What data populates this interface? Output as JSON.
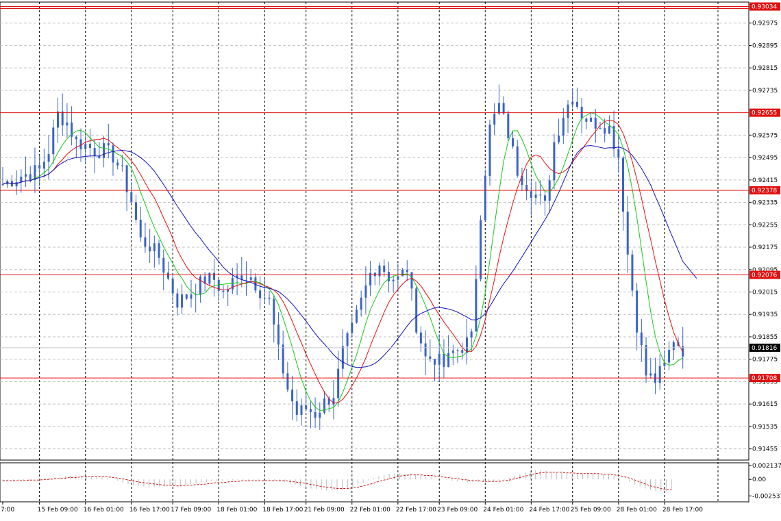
{
  "chart_data": [
    {
      "type": "candlestick",
      "title": "",
      "colors": {
        "candles": "#3a63c8",
        "sma_fast": "#16c816",
        "sma_mid": "#e01010",
        "sma_slow": "#1010c0",
        "level_lines": "#e01010",
        "grid": "#c0c0c0",
        "current_price_bg": "#000000",
        "level_label_bg": "#e01010"
      },
      "ylim": [
        0.91415,
        0.9305
      ],
      "y_ticks": [
        "0.92975",
        "0.92895",
        "0.92815",
        "0.92735",
        "0.92575",
        "0.92495",
        "0.92415",
        "0.92335",
        "0.92255",
        "0.92175",
        "0.92095",
        "0.92015",
        "0.91935",
        "0.91855",
        "0.91775",
        "0.91695",
        "0.91615",
        "0.91535",
        "0.91455"
      ],
      "x_ticks": [
        "7:00",
        "15 Feb 09:00",
        "16 Feb 01:00",
        "16 Feb 17:00",
        "17 Feb 09:00",
        "18 Feb 01:00",
        "18 Feb 17:00",
        "21 Feb 09:00",
        "22 Feb 01:00",
        "22 Feb 17:00",
        "23 Feb 09:00",
        "24 Feb 01:00",
        "24 Feb 17:00",
        "25 Feb 09:00",
        "28 Feb 01:00",
        "28 Feb 17:00"
      ],
      "levels": [
        {
          "value": 0.93034,
          "label": "0.93034"
        },
        {
          "value": 0.92655,
          "label": "0.92655"
        },
        {
          "value": 0.92378,
          "label": "0.92378"
        },
        {
          "value": 0.92076,
          "label": "0.92076"
        },
        {
          "value": 0.91708,
          "label": "0.91708"
        }
      ],
      "current_price": {
        "value": 0.91816,
        "label": "0.91816"
      },
      "close_path": [
        [
          0,
          0.924
        ],
        [
          4,
          0.9243
        ],
        [
          8,
          0.9245
        ],
        [
          10,
          0.9252
        ],
        [
          12,
          0.9265
        ],
        [
          14,
          0.9262
        ],
        [
          16,
          0.9255
        ],
        [
          18,
          0.9254
        ],
        [
          20,
          0.9252
        ],
        [
          22,
          0.9252
        ],
        [
          24,
          0.925
        ],
        [
          26,
          0.9244
        ],
        [
          28,
          0.9234
        ],
        [
          30,
          0.922
        ],
        [
          32,
          0.9218
        ],
        [
          34,
          0.9214
        ],
        [
          36,
          0.9206
        ],
        [
          38,
          0.9198
        ],
        [
          40,
          0.92
        ],
        [
          42,
          0.9203
        ],
        [
          44,
          0.9206
        ],
        [
          46,
          0.9206
        ],
        [
          48,
          0.9201
        ],
        [
          50,
          0.9205
        ],
        [
          52,
          0.9208
        ],
        [
          54,
          0.9207
        ],
        [
          56,
          0.9202
        ],
        [
          58,
          0.9198
        ],
        [
          60,
          0.918
        ],
        [
          62,
          0.9167
        ],
        [
          64,
          0.9158
        ],
        [
          66,
          0.916
        ],
        [
          68,
          0.9158
        ],
        [
          70,
          0.9162
        ],
        [
          72,
          0.9165
        ],
        [
          74,
          0.918
        ],
        [
          76,
          0.9188
        ],
        [
          78,
          0.9198
        ],
        [
          80,
          0.9208
        ],
        [
          82,
          0.9212
        ],
        [
          84,
          0.9207
        ],
        [
          86,
          0.9206
        ],
        [
          88,
          0.921
        ],
        [
          90,
          0.919
        ],
        [
          92,
          0.9178
        ],
        [
          94,
          0.9178
        ],
        [
          96,
          0.9175
        ],
        [
          98,
          0.918
        ],
        [
          100,
          0.9182
        ],
        [
          102,
          0.9185
        ],
        [
          104,
          0.923
        ],
        [
          106,
          0.926
        ],
        [
          108,
          0.9268
        ],
        [
          110,
          0.9258
        ],
        [
          112,
          0.9245
        ],
        [
          114,
          0.924
        ],
        [
          116,
          0.9236
        ],
        [
          118,
          0.9232
        ],
        [
          120,
          0.9255
        ],
        [
          122,
          0.9265
        ],
        [
          124,
          0.9272
        ],
        [
          126,
          0.9265
        ],
        [
          128,
          0.9262
        ],
        [
          130,
          0.9262
        ],
        [
          132,
          0.926
        ],
        [
          134,
          0.925
        ],
        [
          136,
          0.9215
        ],
        [
          138,
          0.919
        ],
        [
          140,
          0.9172
        ],
        [
          142,
          0.917
        ],
        [
          144,
          0.9175
        ],
        [
          146,
          0.9185
        ],
        [
          148,
          0.9181
        ]
      ],
      "x_labels_per_bar": [
        {
          "label": "7:00",
          "bar": 0
        },
        {
          "label": "15 Feb 09:00",
          "bar": 8
        },
        {
          "label": "16 Feb 01:00",
          "bar": 18
        },
        {
          "label": "16 Feb 17:00",
          "bar": 28
        },
        {
          "label": "17 Feb 09:00",
          "bar": 37
        },
        {
          "label": "18 Feb 01:00",
          "bar": 47
        },
        {
          "label": "18 Feb 17:00",
          "bar": 57
        },
        {
          "label": "21 Feb 09:00",
          "bar": 66
        },
        {
          "label": "22 Feb 01:00",
          "bar": 76
        },
        {
          "label": "22 Feb 17:00",
          "bar": 86
        },
        {
          "label": "23 Feb 09:00",
          "bar": 95
        },
        {
          "label": "24 Feb 01:00",
          "bar": 105
        },
        {
          "label": "24 Feb 17:00",
          "bar": 115
        },
        {
          "label": "25 Feb 09:00",
          "bar": 124
        },
        {
          "label": "28 Feb 01:00",
          "bar": 134
        },
        {
          "label": "28 Feb 17:00",
          "bar": 144
        }
      ]
    },
    {
      "type": "histogram",
      "title": "",
      "ylim": [
        -0.00345,
        0.00255
      ],
      "y_ticks": [
        "0.002137",
        "0.00",
        "-0.002537"
      ],
      "series": [
        {
          "values": [
            -0.0003,
            -0.0003,
            -0.0002,
            -0.0002,
            -0.0001,
            -0.0001,
            0.0,
            0.0001,
            0.0001,
            0.0002,
            0.0003,
            0.0004,
            0.0005,
            0.0006,
            0.0006,
            0.0006,
            0.0005,
            0.0005,
            0.0004,
            0.0003,
            0.0002,
            0.0,
            -0.0002,
            -0.0005,
            -0.0007,
            -0.0009,
            -0.001,
            -0.0011,
            -0.0012,
            -0.0012,
            -0.0011,
            -0.0011,
            -0.001,
            -0.001,
            -0.0009,
            -0.0008,
            -0.0007,
            -0.0006,
            -0.0005,
            -0.0004,
            -0.0003,
            -0.0002,
            -0.0002,
            -0.0001,
            -0.0001,
            -0.0001,
            -0.0001,
            -0.0001,
            -0.0001,
            -0.0001,
            -0.0002,
            -0.0002,
            -0.0002,
            -0.0003,
            -0.0004,
            -0.0006,
            -0.0008,
            -0.001,
            -0.0012,
            -0.0014,
            -0.0015,
            -0.0016,
            -0.0017,
            -0.0017,
            -0.0017,
            -0.0016,
            -0.0014,
            -0.0011,
            -0.0008,
            -0.0005,
            -0.0001,
            0.0002,
            0.0005,
            0.0007,
            0.0008,
            0.0009,
            0.0009,
            0.0009,
            0.0008,
            0.0007,
            0.0006,
            0.0004,
            0.0003,
            0.0001,
            0.0,
            -0.0001,
            -0.0002,
            -0.0003,
            -0.0003,
            -0.0004,
            -0.0004,
            -0.0004,
            -0.0004,
            -0.0004,
            -0.0003,
            -0.0002,
            -0.0001,
            0.0002,
            0.0005,
            0.0008,
            0.0011,
            0.0013,
            0.0014,
            0.0014,
            0.0013,
            0.0012,
            0.0011,
            0.001,
            0.0009,
            0.0008,
            0.0008,
            0.0009,
            0.0009,
            0.0009,
            0.0008,
            0.0008,
            0.0007,
            0.0005,
            0.0003,
            0.0,
            -0.0004,
            -0.0008,
            -0.0011,
            -0.0014,
            -0.0016,
            -0.0018,
            -0.0018,
            -0.0018,
            -0.0017
          ]
        },
        {
          "values": [
            -0.0002,
            -0.0002,
            -0.0002,
            -0.0002,
            -0.0002,
            -0.0001,
            -0.0001,
            -0.0001,
            0.0,
            0.0,
            0.0001,
            0.0001,
            0.0002,
            0.0003,
            0.0003,
            0.0004,
            0.0004,
            0.0004,
            0.0004,
            0.0004,
            0.0004,
            0.0003,
            0.0002,
            0.0001,
            -0.0001,
            -0.0002,
            -0.0004,
            -0.0005,
            -0.0006,
            -0.0007,
            -0.0008,
            -0.0009,
            -0.0009,
            -0.001,
            -0.001,
            -0.0009,
            -0.0009,
            -0.0008,
            -0.0008,
            -0.0007,
            -0.0006,
            -0.0005,
            -0.0005,
            -0.0004,
            -0.0003,
            -0.0003,
            -0.0002,
            -0.0002,
            -0.0002,
            -0.0002,
            -0.0002,
            -0.0002,
            -0.0002,
            -0.0002,
            -0.0002,
            -0.0003,
            -0.0004,
            -0.0005,
            -0.0006,
            -0.0008,
            -0.0009,
            -0.0011,
            -0.0012,
            -0.0013,
            -0.0014,
            -0.0014,
            -0.0014,
            -0.0013,
            -0.0012,
            -0.001,
            -0.0008,
            -0.0006,
            -0.0003,
            -0.0001,
            0.0001,
            0.0003,
            0.0005,
            0.0006,
            0.0007,
            0.0007,
            0.0007,
            0.0006,
            0.0006,
            0.0005,
            0.0004,
            0.0003,
            0.0002,
            0.0001,
            0.0,
            -0.0001,
            -0.0002,
            -0.0002,
            -0.0003,
            -0.0003,
            -0.0003,
            -0.0003,
            -0.0002,
            -0.0001,
            0.0001,
            0.0003,
            0.0005,
            0.0007,
            0.0009,
            0.001,
            0.0011,
            0.0011,
            0.0011,
            0.0011,
            0.001,
            0.001,
            0.0009,
            0.0009,
            0.0009,
            0.0009,
            0.0009,
            0.0008,
            0.0008,
            0.0007,
            0.0006,
            0.0004,
            0.0002,
            -0.0001,
            -0.0004,
            -0.0007,
            -0.001,
            -0.0012,
            -0.0014,
            -0.0016,
            -0.0016
          ]
        }
      ]
    }
  ]
}
